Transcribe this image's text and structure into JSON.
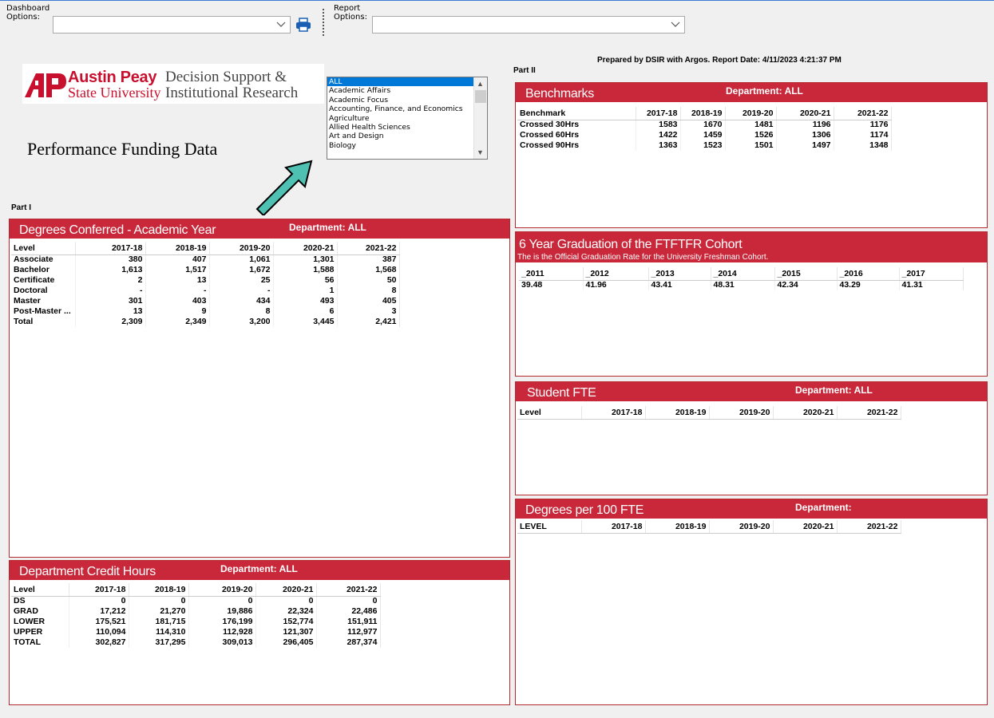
{
  "toolbar": {
    "dashboard_label_1": "Dashboard",
    "dashboard_label_2": "Options:",
    "dashboard_value": "",
    "report_label_1": "Report",
    "report_label_2": "Options:",
    "report_value": ""
  },
  "logo": {
    "ap": "AP",
    "name1": "Austin Peay",
    "name2": "State University",
    "dsir1": "Decision Support &",
    "dsir2": "Institutional Research"
  },
  "title": "Performance Funding Data",
  "department_list": {
    "items": [
      "ALL",
      "Academic Affairs",
      "Academic Focus",
      "Accounting, Finance, and Economics",
      "Agriculture",
      "Allied Health Sciences",
      "Art and Design",
      "Biology"
    ],
    "selected": "ALL"
  },
  "part1_label": "Part I",
  "part2_label": "Part II",
  "prepared_by": "Prepared by DSIR with Argos. Report Date:  4/11/2023 4:21:37 PM",
  "degrees": {
    "title": "Degrees Conferred - Academic Year",
    "department": "Department: ALL",
    "columns": [
      "Level",
      "2017-18",
      "2018-19",
      "2019-20",
      "2020-21",
      "2021-22"
    ],
    "rows": [
      [
        "Associate",
        "380",
        "407",
        "1,061",
        "1,301",
        "387"
      ],
      [
        "Bachelor",
        "1,613",
        "1,517",
        "1,672",
        "1,588",
        "1,568"
      ],
      [
        "Certificate",
        "2",
        "13",
        "25",
        "56",
        "50"
      ],
      [
        "Doctoral",
        "-",
        "-",
        "-",
        "1",
        "8"
      ],
      [
        "Master",
        "301",
        "403",
        "434",
        "493",
        "405"
      ],
      [
        "Post-Master ...",
        "13",
        "9",
        "8",
        "6",
        "3"
      ],
      [
        "Total",
        "2,309",
        "2,349",
        "3,200",
        "3,445",
        "2,421"
      ]
    ]
  },
  "credit_hours": {
    "title": "Department Credit Hours",
    "department": "Department: ALL",
    "columns": [
      "Level",
      "2017-18",
      "2018-19",
      "2019-20",
      "2020-21",
      "2021-22"
    ],
    "rows": [
      [
        "DS",
        "0",
        "0",
        "0",
        "0",
        "0"
      ],
      [
        "GRAD",
        "17,212",
        "21,270",
        "19,886",
        "22,324",
        "22,486"
      ],
      [
        "LOWER",
        "175,521",
        "181,715",
        "176,199",
        "152,774",
        "151,911"
      ],
      [
        "UPPER",
        "110,094",
        "114,310",
        "112,928",
        "121,307",
        "112,977"
      ],
      [
        "TOTAL",
        "302,827",
        "317,295",
        "309,013",
        "296,405",
        "287,374"
      ]
    ]
  },
  "benchmarks": {
    "title": "Benchmarks",
    "department": "Department: ALL",
    "columns": [
      "Benchmark",
      "2017-18",
      "2018-19",
      "2019-20",
      "2020-21",
      "2021-22"
    ],
    "rows": [
      [
        "Crossed 30Hrs",
        "1583",
        "1670",
        "1481",
        "1196",
        "1176"
      ],
      [
        "Crossed 60Hrs",
        "1422",
        "1459",
        "1526",
        "1306",
        "1174"
      ],
      [
        "Crossed 90Hrs",
        "1363",
        "1523",
        "1501",
        "1497",
        "1348"
      ]
    ]
  },
  "graduation": {
    "title": "6 Year Graduation of the FTFTFR Cohort",
    "subtitle": "The is the Official Graduation Rate for the University Freshman Cohort.",
    "columns": [
      "_2011",
      "_2012",
      "_2013",
      "_2014",
      "_2015",
      "_2016",
      "_2017"
    ],
    "rows": [
      [
        "39.48",
        "41.96",
        "43.41",
        "48.31",
        "42.34",
        "43.29",
        "41.31"
      ]
    ]
  },
  "student_fte": {
    "title": "Student FTE",
    "department": "Department: ALL",
    "columns": [
      "Level",
      "2017-18",
      "2018-19",
      "2019-20",
      "2020-21",
      "2021-22"
    ]
  },
  "degrees_per_fte": {
    "title": "Degrees per 100 FTE",
    "department": "Department:",
    "columns": [
      "LEVEL",
      "2017-18",
      "2018-19",
      "2019-20",
      "2020-21",
      "2021-22"
    ]
  },
  "colors": {
    "panel_header": "#c8283a",
    "brand_red": "#c8102e",
    "selection": "#0078d7",
    "arrow_fill": "#4fc1b3"
  },
  "icons": {
    "print": "printer-icon",
    "dropdown": "chevron-down-icon"
  }
}
